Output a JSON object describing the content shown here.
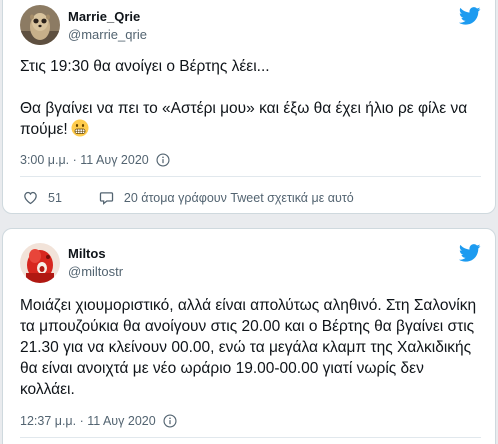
{
  "tweets": [
    {
      "display_name": "Marrie_Qrie",
      "handle": "@marrie_qrie",
      "avatar_icon": "meerkat-avatar",
      "paragraphs": [
        "Στις 19:30 θα ανοίγει ο Βέρτης λέει...",
        "Θα βγαίνει να πει το «Αστέρι μου» και έξω θα έχει ήλιο ρε φίλε να πούμε!"
      ],
      "emoji": "grimacing-face-emoji",
      "timestamp": "3:00 μ.μ. · 11 Αυγ 2020",
      "likes": "51",
      "conversation": "20 άτομα γράφουν Tweet σχετικά με αυτό"
    },
    {
      "display_name": "Miltos",
      "handle": "@miltostr",
      "avatar_icon": "red-figure-avatar",
      "text": "Μοιάζει χιουμοριστικό, αλλά είναι απολύτως αληθινό. Στη Σαλονίκη τα μπουζούκια θα ανοίγουν στις 20.00 και ο Βέρτης θα βγαίνει στις 21.30 για να κλείνουν 00.00, ενώ τα μεγάλα κλαμπ της Χαλκιδικής θα είναι ανοιχτά με νέο ωράριο 19.00-00.00 γιατί νωρίς δεν κολλάει.",
      "timestamp": "12:37 μ.μ. · 11 Αυγ 2020"
    }
  ],
  "colors": {
    "twitter_blue": "#1d9bf0",
    "text": "#0f1419",
    "muted": "#536471",
    "border": "#cfd9de"
  }
}
